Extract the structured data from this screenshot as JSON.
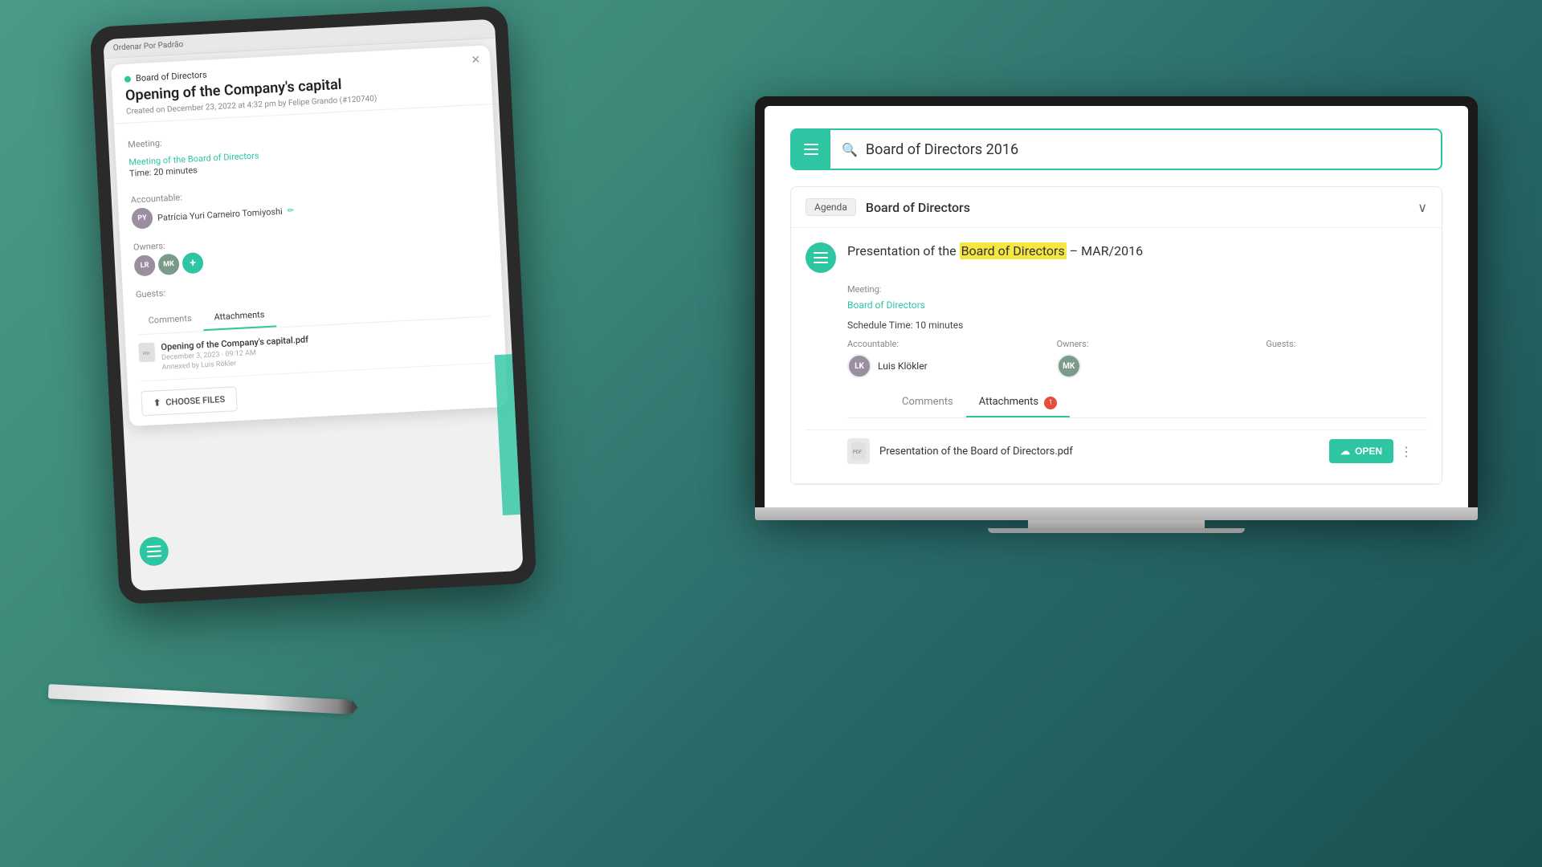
{
  "background": {
    "color": "#3d8a7a"
  },
  "tablet": {
    "top_bar_label": "Ordenar Por Padrão",
    "modal": {
      "group_name": "Board of Directors",
      "title": "Opening of the Company's capital",
      "subtitle": "Created on December 23, 2022 at 4:32 pm by Felipe Grando (#120740)",
      "meeting_label": "Meeting:",
      "meeting_link": "Meeting of the Board of Directors",
      "time_label": "Time: 20 minutes",
      "accountable_label": "Accountable:",
      "accountable_name": "Patrícia Yuri Carneiro Tomiyoshi",
      "owners_label": "Owners:",
      "guests_label": "Guests:",
      "tabs": {
        "comments": "Comments",
        "attachments": "Attachments"
      },
      "attachment": {
        "name": "Opening of the Company's capital.pdf",
        "date": "December 3, 2023 - 09:12 AM",
        "uploaded_by": "Annexed by Luis Rökler"
      },
      "choose_files_btn": "CHOOSE FILES"
    }
  },
  "laptop": {
    "search": {
      "placeholder": "Board of Directors 2016",
      "search_icon": "🔍"
    },
    "agenda": {
      "badge": "Agenda",
      "title": "Board of Directors",
      "chevron": "∨"
    },
    "meeting_item": {
      "title_prefix": "Presentation of the ",
      "title_highlight": "Board of Directors",
      "title_suffix": " – MAR/2016",
      "meeting_label": "Meeting:",
      "meeting_link": "Board of Directors",
      "schedule_label": "Schedule Time: 10 minutes",
      "accountable_label": "Accountable:",
      "accountable_name": "Luis Klökler",
      "owners_label": "Owners:",
      "guests_label": "Guests:"
    },
    "tabs": {
      "comments": "Comments",
      "attachments": "Attachments",
      "attachments_badge": "1"
    },
    "attachment": {
      "name": "Presentation of the Board of Directors.pdf",
      "open_btn": "OPEN",
      "open_icon": "☁"
    }
  }
}
